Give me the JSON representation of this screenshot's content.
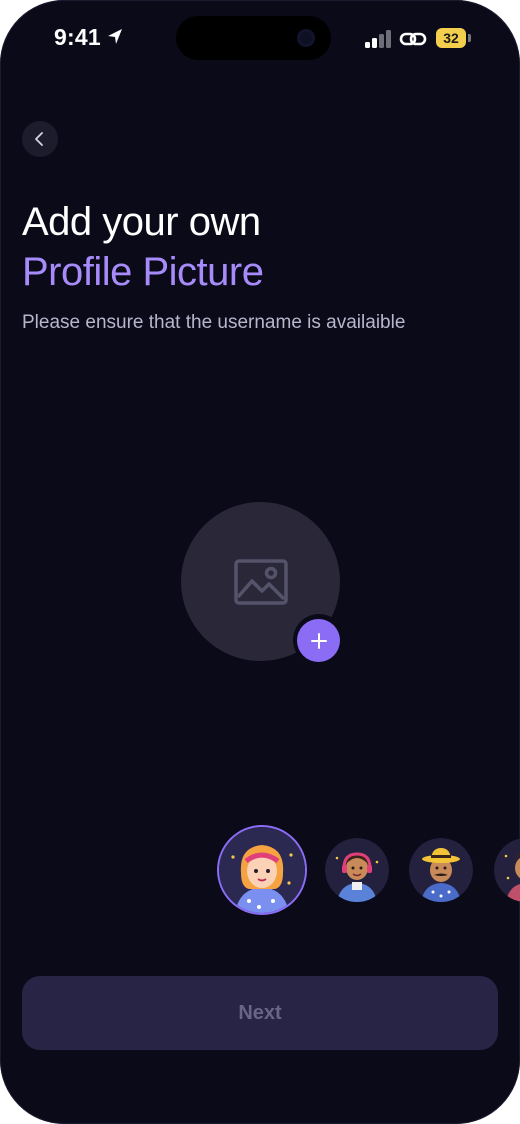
{
  "status_bar": {
    "time": "9:41",
    "battery": "32",
    "icons": [
      "location-arrow-icon",
      "signal-icon",
      "link-icon",
      "battery-icon"
    ]
  },
  "header": {
    "back_icon": "chevron-left-icon"
  },
  "content": {
    "title_line1": "Add your own",
    "title_line2": "Profile Picture",
    "subtitle": "Please ensure that the username is availaible"
  },
  "upload": {
    "placeholder_icon": "image-icon",
    "add_icon": "plus-icon"
  },
  "avatars": {
    "items": [
      "avatar-1",
      "avatar-2",
      "avatar-3",
      "avatar-4"
    ],
    "selected_index": 0
  },
  "footer": {
    "next_label": "Next"
  },
  "colors": {
    "background": "#0b0a18",
    "accent": "#a78bfa",
    "button_bg": "#282445",
    "button_text": "#6a6584",
    "upload_bg": "#2a2838",
    "add_button": "#8b6cf5"
  }
}
